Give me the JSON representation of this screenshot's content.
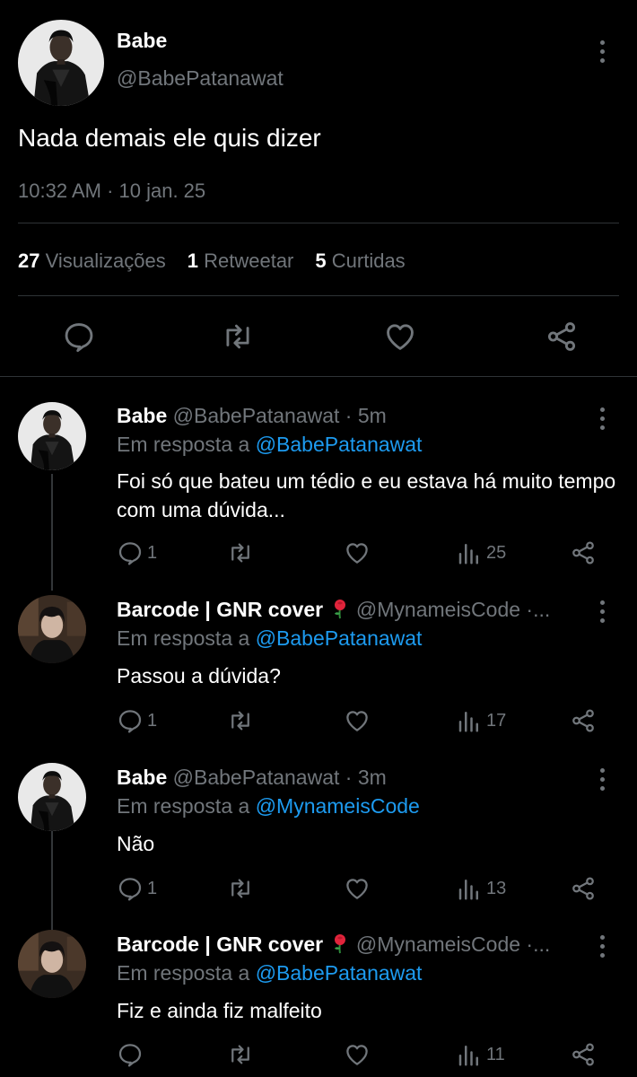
{
  "main": {
    "name": "Babe",
    "handle": "@BabePatanawat",
    "text": "Nada demais ele quis dizer",
    "time": "10:32 AM · 10 jan. 25",
    "stats": {
      "views_count": "27",
      "views_label": "Visualizações",
      "rt_count": "1",
      "rt_label": "Retweetar",
      "likes_count": "5",
      "likes_label": "Curtidas"
    }
  },
  "replies": [
    {
      "name": "Babe",
      "handle": "@BabePatanawat",
      "sep": " · ",
      "time": "5m",
      "reply_prefix": "Em resposta a ",
      "reply_to": "@BabePatanawat",
      "text": "Foi só que bateu um tédio e eu estava há muito tempo com uma dúvida...",
      "comments": "1",
      "views": "25"
    },
    {
      "name": "Barcode | GNR cover",
      "handle": "@MynameisCode ·...",
      "sep": "",
      "time": "",
      "reply_prefix": "Em resposta a ",
      "reply_to": "@BabePatanawat",
      "text": "Passou a dúvida?",
      "comments": "1",
      "views": "17"
    },
    {
      "name": "Babe",
      "handle": "@BabePatanawat",
      "sep": " · ",
      "time": "3m",
      "reply_prefix": "Em resposta a ",
      "reply_to": "@MynameisCode",
      "text": "Não",
      "comments": "1",
      "views": "13"
    },
    {
      "name": "Barcode | GNR cover",
      "handle": "@MynameisCode ·...",
      "sep": "",
      "time": "",
      "reply_prefix": "Em resposta a ",
      "reply_to": "@BabePatanawat",
      "text": "Fiz e ainda fiz malfeito",
      "comments": "",
      "views": "11"
    }
  ],
  "icons": {
    "more": "more-vertical-icon",
    "reply": "reply-bubble-icon",
    "retweet": "retweet-icon",
    "like": "heart-icon",
    "views": "views-bar-icon",
    "share": "share-icon",
    "emoji": "rose-emoji"
  },
  "colors": {
    "background": "#000000",
    "muted": "#71767b",
    "link": "#1d9bf0",
    "text": "#e7e9ea"
  }
}
